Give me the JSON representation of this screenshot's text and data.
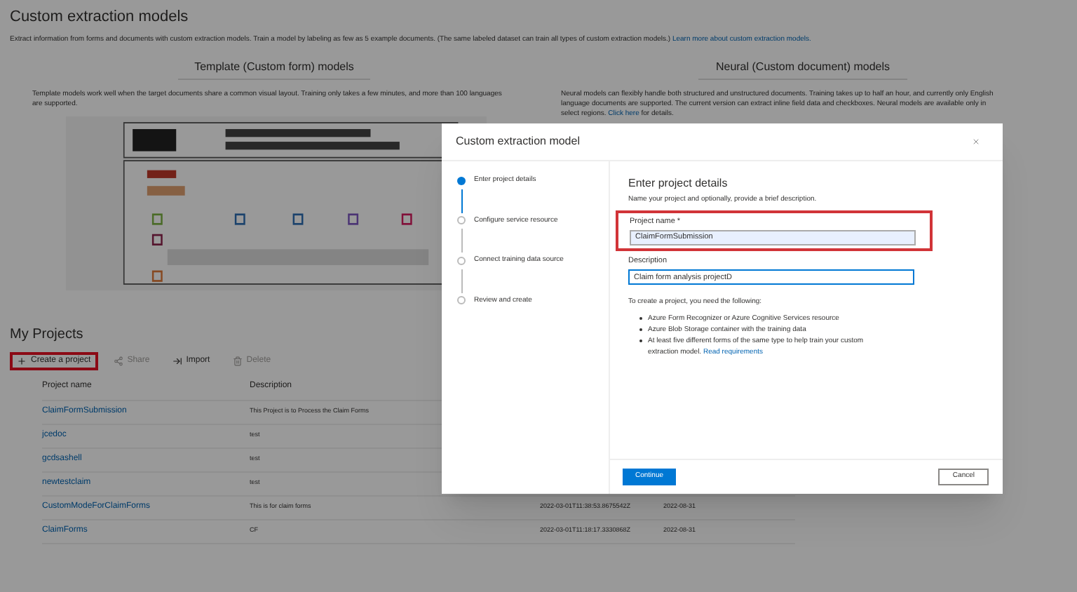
{
  "page": {
    "title": "Custom extraction models",
    "intro": "Extract information from forms and documents with custom extraction models. Train a model by labeling as few as 5 example documents. (The same labeled dataset can train all types of custom extraction models.)",
    "intro_link": "Learn more about custom extraction models."
  },
  "model_types": [
    {
      "title": "Template (Custom form) models",
      "text": "Template models work well when the target documents share a common visual layout. Training only takes a few minutes, and more than 100 languages are supported.",
      "kind": "picture"
    },
    {
      "title": "Neural (Custom document) models",
      "text": "Neural models can flexibly handle both structured and unstructured documents. Training takes up to half an hour, and currently only English language documents are supported. The current version can extract inline field data and checkboxes. Neural models are available only in select regions.",
      "link": "Click here",
      "after_link": "for details."
    }
  ],
  "projects": {
    "title": "My Projects",
    "toolbar": [
      {
        "label": "Create a project",
        "disabled": false,
        "highlighted": true
      },
      {
        "label": "Share",
        "disabled": true,
        "highlighted": false
      },
      {
        "label": "Import",
        "disabled": false,
        "highlighted": false
      },
      {
        "label": "Delete",
        "disabled": true,
        "highlighted": false
      }
    ],
    "columns": [
      "Project name",
      "Description"
    ],
    "rows": [
      {
        "name": "ClaimFormSubmission",
        "description": "This Project is to Process the Claim Forms"
      },
      {
        "name": "jcedoc",
        "description": "test"
      },
      {
        "name": "gcdsashell",
        "description": "test"
      },
      {
        "name": "newtestclaim",
        "description": "test"
      },
      {
        "name": "CustomModeForClaimForms",
        "description": "This is for claim forms",
        "column_3": "2022-03-01T11:38:53.8675542Z",
        "column_4": "2022-08-31"
      },
      {
        "name": "ClaimForms",
        "description": "CF",
        "column_3": "2022-03-01T11:18:17.3330868Z",
        "column_4": "2022-08-31"
      }
    ]
  },
  "dialog": {
    "title": "Custom extraction model",
    "steps": [
      {
        "label": "Enter project details",
        "selected": true
      },
      {
        "label": "Configure service resource",
        "selected": false
      },
      {
        "label": "Connect training data source",
        "selected": false
      },
      {
        "label": "Review and create",
        "selected": false
      }
    ],
    "heading": "Enter project details",
    "subtitle": "Name your project and optionally, provide a brief description.",
    "fields": [
      {
        "label": "Project name *",
        "value": "ClaimFormSubmission",
        "highlighted": true
      },
      {
        "label": "Description",
        "value": "Claim form analysis projectD",
        "highlighted": false
      }
    ],
    "requirements_intro": "To create a project, you need the following:",
    "requirements": [
      {
        "text": "Azure Form Recognizer or Azure Cognitive Services resource"
      },
      {
        "text": "Azure Blob Storage container with the training data"
      },
      {
        "text": "At least five different forms of the same type to help train your custom extraction model.",
        "link": "Read requirements"
      }
    ],
    "buttons": [
      {
        "label": "Continue",
        "kind": "primary"
      },
      {
        "label": "Cancel",
        "kind": "secondary"
      }
    ]
  }
}
